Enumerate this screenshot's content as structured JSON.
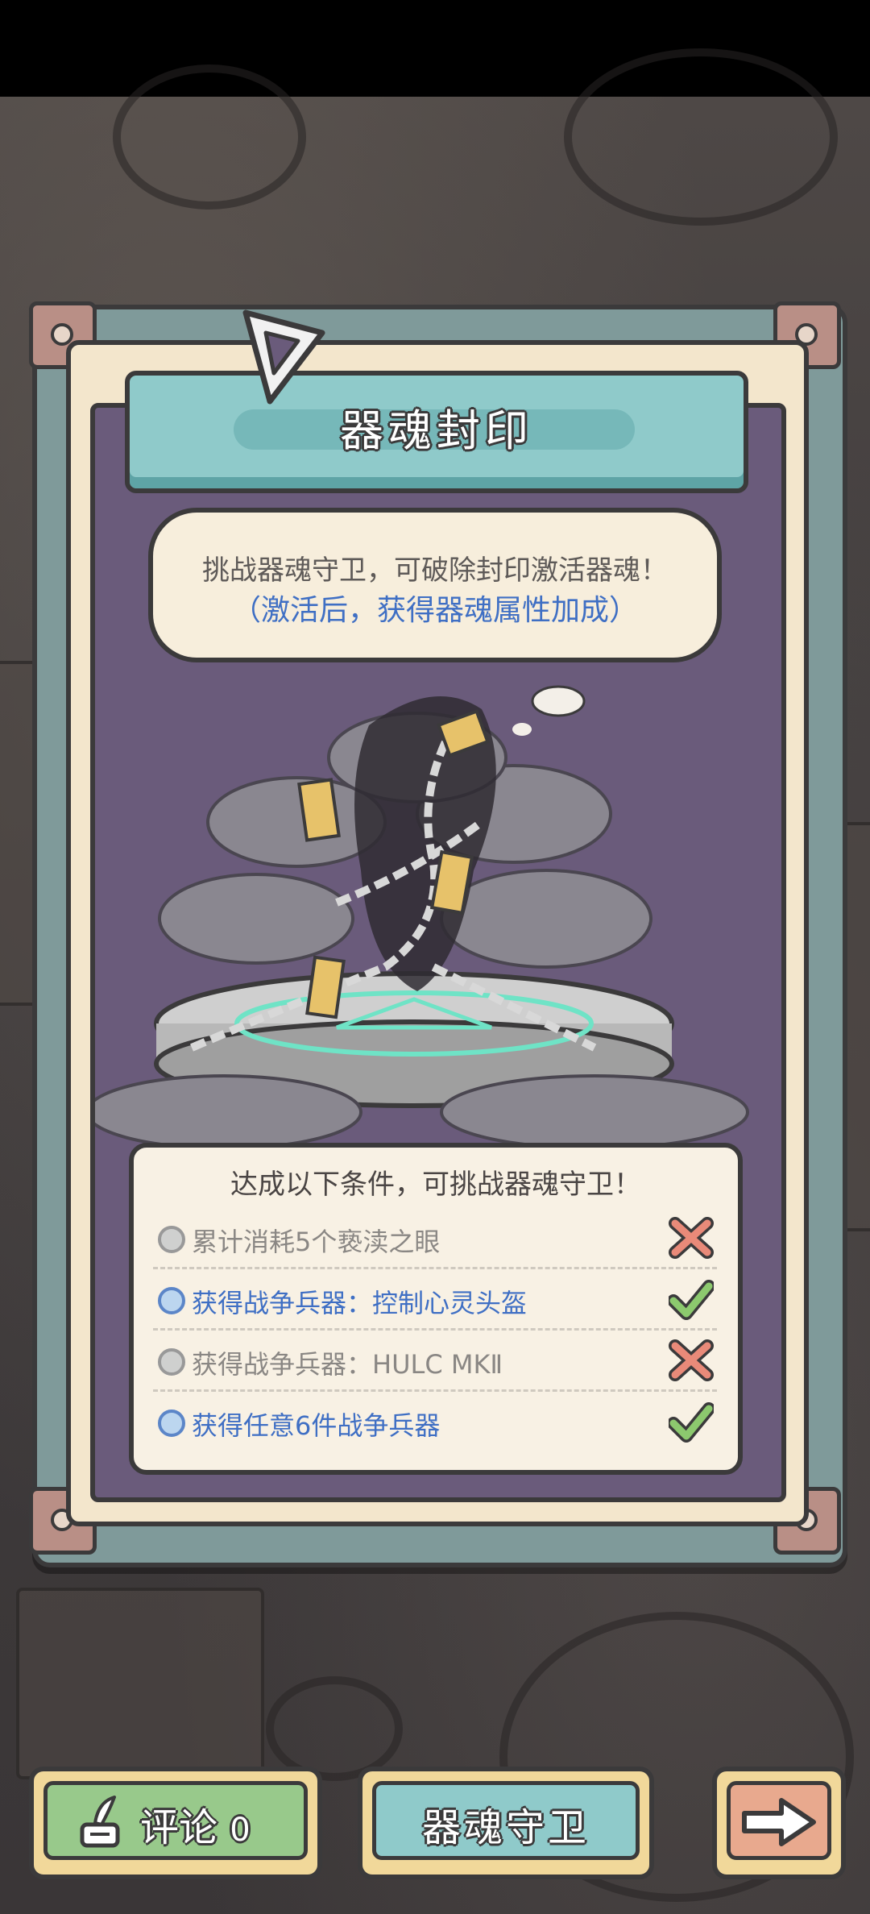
{
  "panel": {
    "title": "器魂封印",
    "speech_line1": "挑战器魂守卫，可破除封印激活器魂！",
    "speech_line2": "（激活后，获得器魂属性加成）"
  },
  "conditions": {
    "title": "达成以下条件，可挑战器魂守卫！",
    "items": [
      {
        "label": "累计消耗5个亵渎之眼",
        "met": false
      },
      {
        "label": "获得战争兵器：控制心灵头盔",
        "met": true
      },
      {
        "label": "获得战争兵器：HULC MKⅡ",
        "met": false
      },
      {
        "label": "获得任意6件战争兵器",
        "met": true
      }
    ]
  },
  "buttons": {
    "comment_label": "评论",
    "comment_count": "0",
    "guard_label": "器魂守卫"
  },
  "icons": {
    "comment": "quill-ink-icon",
    "next": "arrow-right-icon",
    "met": "check-icon",
    "unmet": "cross-icon"
  },
  "colors": {
    "met_text": "#3f6fc4",
    "unmet_text": "#8a8784",
    "check": "#8cc96e",
    "cross": "#e98a79"
  }
}
